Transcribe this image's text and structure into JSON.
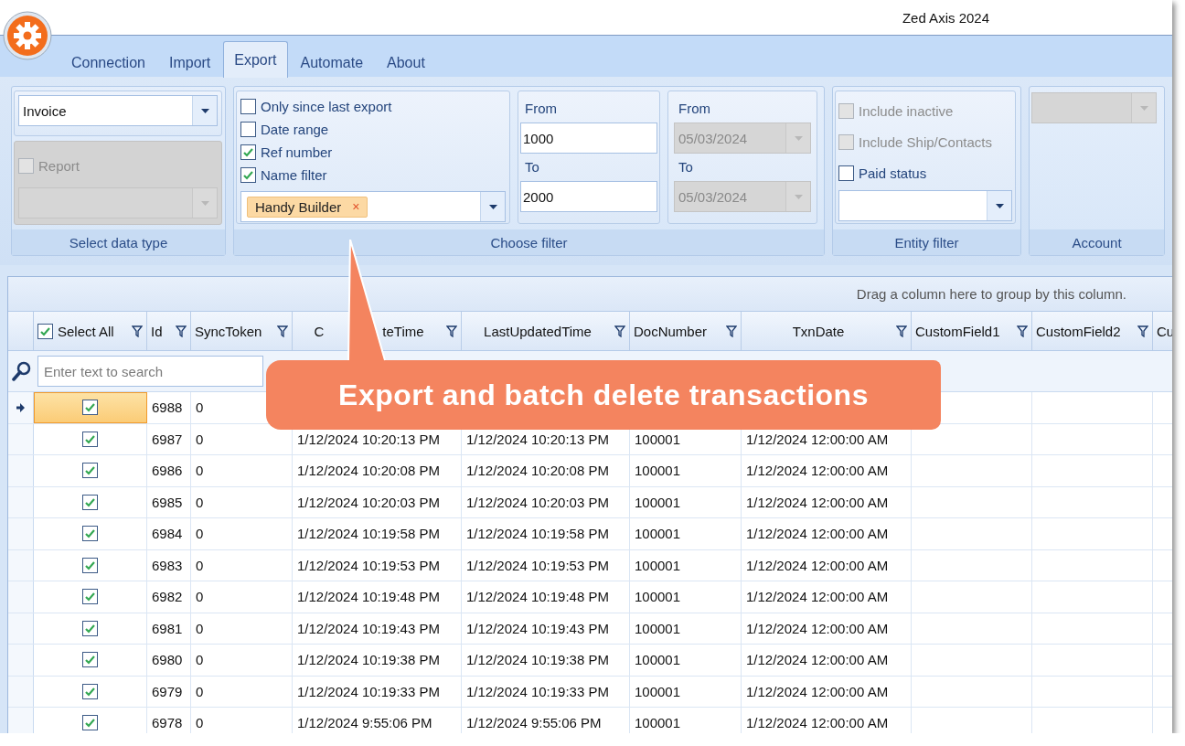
{
  "window": {
    "title": "Zed Axis 2024"
  },
  "tabs": [
    {
      "label": "Connection",
      "selected": false
    },
    {
      "label": "Import",
      "selected": false
    },
    {
      "label": "Export",
      "selected": true
    },
    {
      "label": "Automate",
      "selected": false
    },
    {
      "label": "About",
      "selected": false
    }
  ],
  "ribbon": {
    "data_type": {
      "value": "Invoice",
      "report": {
        "label": "Report",
        "checked": false,
        "disabled": true
      },
      "caption": "Select data type"
    },
    "filter": {
      "options": [
        {
          "label": "Only since last export",
          "checked": false
        },
        {
          "label": "Date range",
          "checked": false
        },
        {
          "label": "Ref number",
          "checked": true
        },
        {
          "label": "Name filter",
          "checked": true
        }
      ],
      "name_tags": [
        {
          "label": "Handy Builder",
          "remove": "×"
        }
      ],
      "ref_from_label": "From",
      "ref_from": "1000",
      "ref_to_label": "To",
      "ref_to": "2000",
      "date_from_label": "From",
      "date_from": "05/03/2024",
      "date_to_label": "To",
      "date_to": "05/03/2024",
      "dates_disabled": true,
      "caption": "Choose filter"
    },
    "entity": {
      "options": [
        {
          "label": "Include inactive",
          "checked": false,
          "disabled": true
        },
        {
          "label": "Include Ship/Contacts",
          "checked": false,
          "disabled": true
        },
        {
          "label": "Paid status",
          "checked": false,
          "disabled": false
        }
      ],
      "caption": "Entity filter"
    },
    "account": {
      "caption": "Account",
      "disabled": true
    }
  },
  "grid": {
    "group_hint": "Drag a column here to group by this column.",
    "select_column": {
      "label": "Select All",
      "checked": true
    },
    "columns": [
      {
        "label": "Id"
      },
      {
        "label": "SyncToken"
      },
      {
        "label": "C",
        "label_after": "teTime"
      },
      {
        "label": "LastUpdatedTime"
      },
      {
        "label": "DocNumber"
      },
      {
        "label": "TxnDate"
      },
      {
        "label": "CustomField1"
      },
      {
        "label": "CustomField2"
      },
      {
        "label": "Cu"
      }
    ],
    "search_placeholder": "Enter text to search",
    "rows": [
      {
        "selected": true,
        "checked": true,
        "cells": [
          "6988",
          "0"
        ]
      },
      {
        "selected": false,
        "checked": true,
        "cells": [
          "6987",
          "0",
          "1/12/2024 10:20:13 PM",
          "1/12/2024 10:20:13 PM",
          "100001",
          "1/12/2024 12:00:00 AM"
        ]
      },
      {
        "selected": false,
        "checked": true,
        "cells": [
          "6986",
          "0",
          "1/12/2024 10:20:08 PM",
          "1/12/2024 10:20:08 PM",
          "100001",
          "1/12/2024 12:00:00 AM"
        ]
      },
      {
        "selected": false,
        "checked": true,
        "cells": [
          "6985",
          "0",
          "1/12/2024 10:20:03 PM",
          "1/12/2024 10:20:03 PM",
          "100001",
          "1/12/2024 12:00:00 AM"
        ]
      },
      {
        "selected": false,
        "checked": true,
        "cells": [
          "6984",
          "0",
          "1/12/2024 10:19:58 PM",
          "1/12/2024 10:19:58 PM",
          "100001",
          "1/12/2024 12:00:00 AM"
        ]
      },
      {
        "selected": false,
        "checked": true,
        "cells": [
          "6983",
          "0",
          "1/12/2024 10:19:53 PM",
          "1/12/2024 10:19:53 PM",
          "100001",
          "1/12/2024 12:00:00 AM"
        ]
      },
      {
        "selected": false,
        "checked": true,
        "cells": [
          "6982",
          "0",
          "1/12/2024 10:19:48 PM",
          "1/12/2024 10:19:48 PM",
          "100001",
          "1/12/2024 12:00:00 AM"
        ]
      },
      {
        "selected": false,
        "checked": true,
        "cells": [
          "6981",
          "0",
          "1/12/2024 10:19:43 PM",
          "1/12/2024 10:19:43 PM",
          "100001",
          "1/12/2024 12:00:00 AM"
        ]
      },
      {
        "selected": false,
        "checked": true,
        "cells": [
          "6980",
          "0",
          "1/12/2024 10:19:38 PM",
          "1/12/2024 10:19:38 PM",
          "100001",
          "1/12/2024 12:00:00 AM"
        ]
      },
      {
        "selected": false,
        "checked": true,
        "cells": [
          "6979",
          "0",
          "1/12/2024 10:19:33 PM",
          "1/12/2024 10:19:33 PM",
          "100001",
          "1/12/2024 12:00:00 AM"
        ]
      },
      {
        "selected": false,
        "checked": true,
        "cells": [
          "6978",
          "0",
          "1/12/2024 9:55:06 PM",
          "1/12/2024 9:55:06 PM",
          "100001",
          "1/12/2024 12:00:00 AM"
        ]
      }
    ]
  },
  "callout": {
    "text": "Export and batch delete transactions"
  }
}
